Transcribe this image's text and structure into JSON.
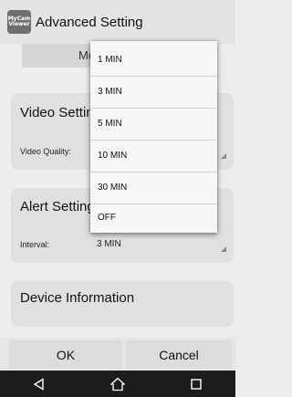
{
  "titlebar": {
    "icon_text_line1": "MyCam",
    "icon_text_line2": "Viewer",
    "title": "Advanced Setting"
  },
  "mode_strip": {
    "text": "Mo"
  },
  "video_settings": {
    "title": "Video Setting",
    "quality_label": "Video Quality:"
  },
  "alert_settings": {
    "title": "Alert Setting",
    "interval_label": "Interval:",
    "interval_value": "3 MIN"
  },
  "device_info": {
    "title": "Device Information"
  },
  "buttons": {
    "ok": "OK",
    "cancel": "Cancel"
  },
  "navbar": {
    "back_icon": "back-triangle",
    "home_icon": "home-house",
    "recents_icon": "recents-square"
  },
  "menu": {
    "items": [
      "1 MIN",
      "3 MIN",
      "5 MIN",
      "10 MIN",
      "30 MIN",
      "OFF"
    ]
  }
}
